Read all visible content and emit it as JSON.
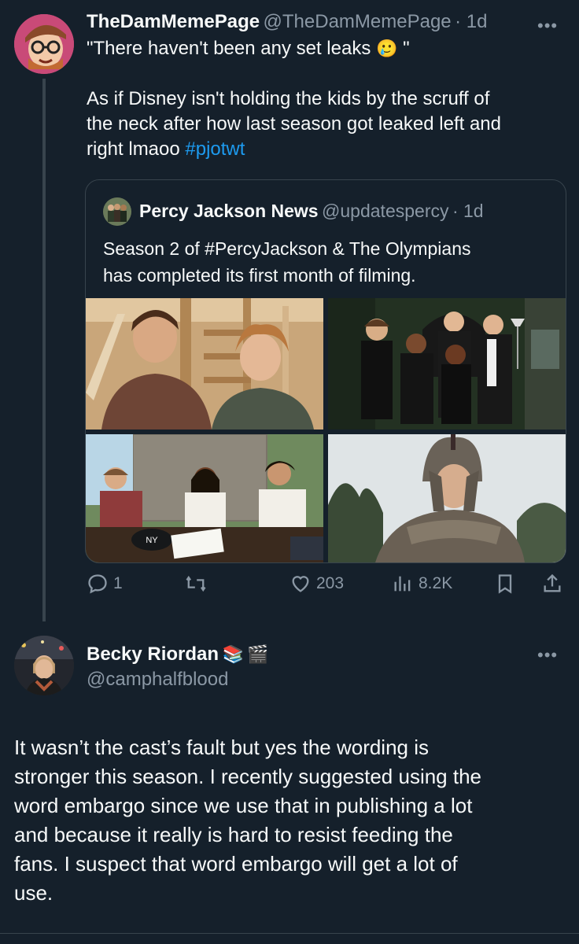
{
  "tweet1": {
    "author_name": "TheDamMemePage",
    "author_handle": "@TheDamMemePage",
    "time": "· 1d",
    "more": "•••",
    "quote_line": "\"There haven't been any set leaks",
    "quote_emoji": "🥲",
    "quote_end": "\"",
    "body_l1": "As if Disney isn't holding the kids by the scruff of",
    "body_l2": "the neck after how last season got leaked left and",
    "body_l3": "right lmaoo ",
    "hashtag": "#pjotwt"
  },
  "quoted": {
    "author_name": "Percy Jackson News",
    "author_handle": "@updatespercy",
    "time": "· 1d",
    "text_l1": "Season 2 of #PercyJackson & The Olympians",
    "text_l2": "has completed its first month of filming."
  },
  "actions": {
    "replies": "1",
    "retweets": "",
    "likes": "203",
    "views": "8.2K"
  },
  "tweet2": {
    "author_name": "Becky Riordan",
    "emoji_books": "📚",
    "emoji_clapper": "🎬",
    "author_handle": "@camphalfblood",
    "more": "•••",
    "body_l1": "It wasn’t the cast’s fault but yes the wording is",
    "body_l2": "stronger this season. I recently suggested using the",
    "body_l3": "word embargo since we use that in publishing a lot",
    "body_l4": "and because it really is hard to resist feeding the",
    "body_l5": "fans. I suspect that word embargo will get a lot of",
    "body_l6": "use."
  },
  "colors": {
    "background": "#15202b",
    "text": "#f7f9f9",
    "muted": "#8b98a5",
    "link": "#1d9bf0",
    "border": "#38444d"
  }
}
